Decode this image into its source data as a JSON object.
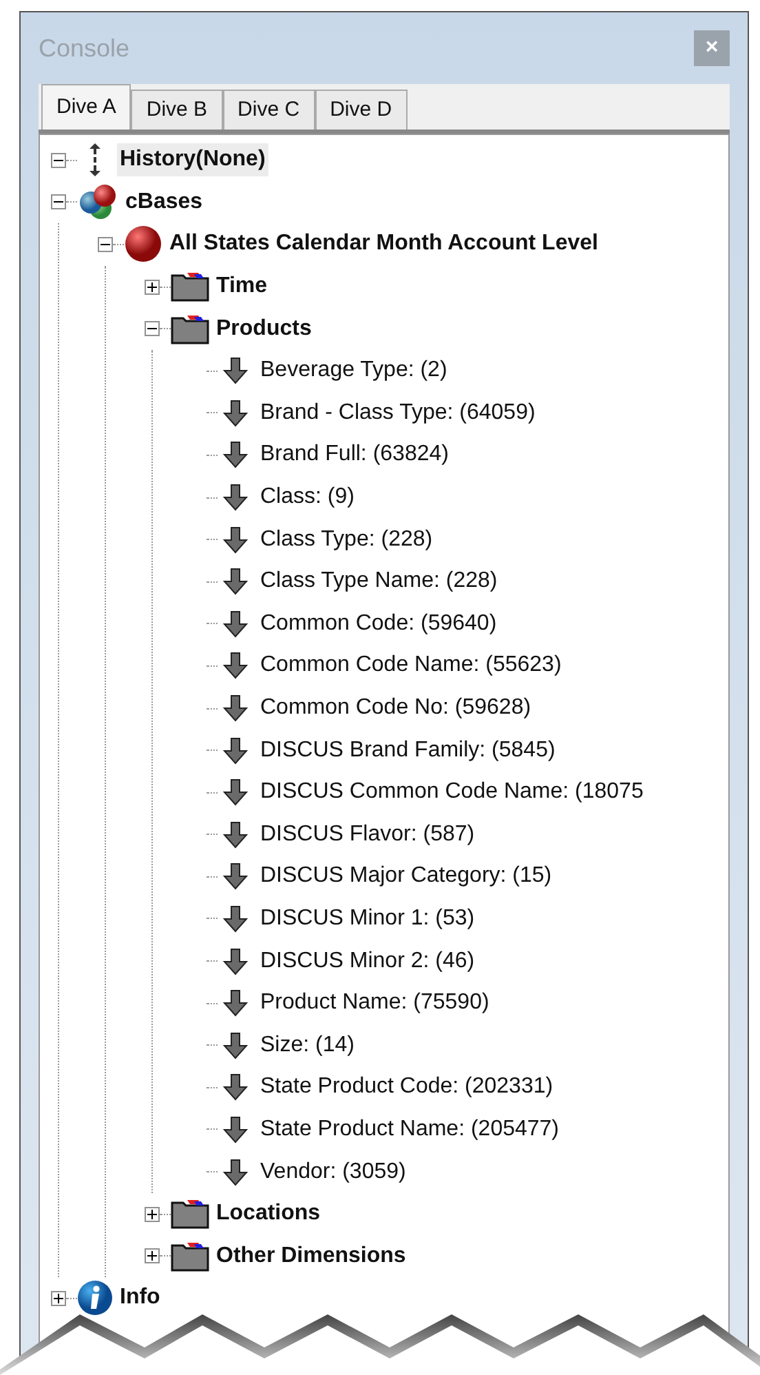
{
  "window": {
    "title": "Console",
    "close": "×"
  },
  "tabs": [
    {
      "label": "Dive A",
      "selected": true
    },
    {
      "label": "Dive B",
      "selected": false
    },
    {
      "label": "Dive C",
      "selected": false
    },
    {
      "label": "Dive D",
      "selected": false
    }
  ],
  "tree": [
    {
      "kind": "history",
      "label": "History(None)",
      "expanded": true,
      "selected": true
    },
    {
      "kind": "cbases",
      "label": "cBases",
      "expanded": true,
      "selected": false,
      "children": [
        {
          "kind": "cube",
          "label": "All States Calendar Month Account Level",
          "expanded": true,
          "selected": false,
          "children": [
            {
              "kind": "folder",
              "label": "Time",
              "expanded": false,
              "selected": false
            },
            {
              "kind": "folder",
              "label": "Products",
              "expanded": true,
              "selected": false,
              "children": [
                {
                  "kind": "attribute",
                  "label": "Beverage Type: (2)",
                  "selected": false
                },
                {
                  "kind": "attribute",
                  "label": "Brand - Class Type: (64059)",
                  "selected": false
                },
                {
                  "kind": "attribute",
                  "label": "Brand Full: (63824)",
                  "selected": false
                },
                {
                  "kind": "attribute",
                  "label": "Class: (9)",
                  "selected": false
                },
                {
                  "kind": "attribute",
                  "label": "Class Type: (228)",
                  "selected": false
                },
                {
                  "kind": "attribute",
                  "label": "Class Type Name: (228)",
                  "selected": false
                },
                {
                  "kind": "attribute",
                  "label": "Common Code: (59640)",
                  "selected": false
                },
                {
                  "kind": "attribute",
                  "label": "Common Code Name: (55623)",
                  "selected": false
                },
                {
                  "kind": "attribute",
                  "label": "Common Code No: (59628)",
                  "selected": false
                },
                {
                  "kind": "attribute",
                  "label": "DISCUS Brand Family: (5845)",
                  "selected": false
                },
                {
                  "kind": "attribute",
                  "label": "DISCUS Common Code Name: (18075",
                  "selected": false
                },
                {
                  "kind": "attribute",
                  "label": "DISCUS Flavor: (587)",
                  "selected": false
                },
                {
                  "kind": "attribute",
                  "label": "DISCUS Major Category: (15)",
                  "selected": false
                },
                {
                  "kind": "attribute",
                  "label": "DISCUS Minor 1: (53)",
                  "selected": false
                },
                {
                  "kind": "attribute",
                  "label": "DISCUS Minor 2: (46)",
                  "selected": false
                },
                {
                  "kind": "attribute",
                  "label": "Product Name: (75590)",
                  "selected": false
                },
                {
                  "kind": "attribute",
                  "label": "Size: (14)",
                  "selected": false
                },
                {
                  "kind": "attribute",
                  "label": "State Product Code: (202331)",
                  "selected": false
                },
                {
                  "kind": "attribute",
                  "label": "State Product Name: (205477)",
                  "selected": false
                },
                {
                  "kind": "attribute",
                  "label": "Vendor: (3059)",
                  "selected": false
                }
              ]
            },
            {
              "kind": "folder",
              "label": "Locations",
              "expanded": false,
              "selected": false
            },
            {
              "kind": "folder",
              "label": "Other Dimensions",
              "expanded": false,
              "selected": false
            }
          ]
        }
      ]
    },
    {
      "kind": "info",
      "label": "Info",
      "expanded": false,
      "selected": false
    }
  ]
}
